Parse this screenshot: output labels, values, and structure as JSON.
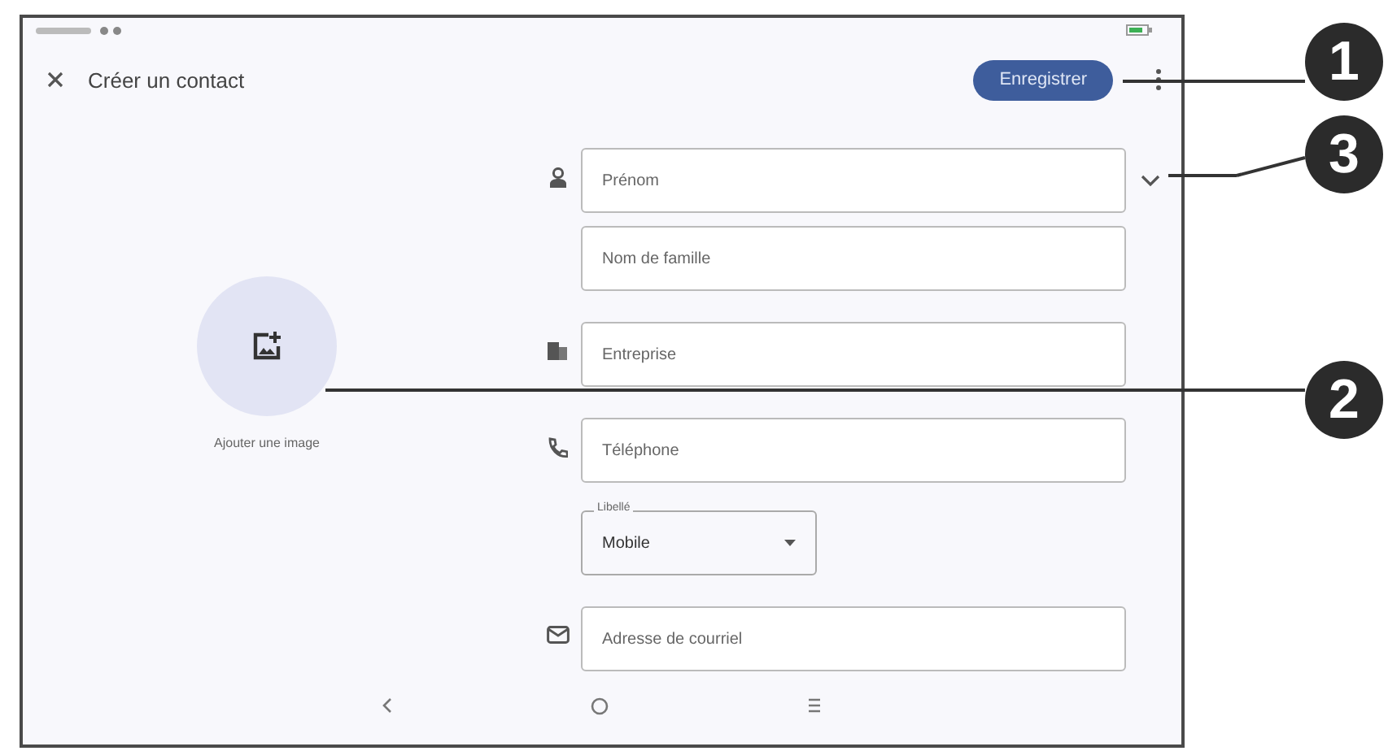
{
  "header": {
    "title": "Créer un contact",
    "save_button": "Enregistrer"
  },
  "photo": {
    "label": "Ajouter une image"
  },
  "sections": [
    {
      "kind": "name",
      "expandable": true,
      "fields": [
        {
          "placeholder": "Prénom"
        },
        {
          "placeholder": "Nom de famille"
        }
      ]
    },
    {
      "kind": "company",
      "expandable": false,
      "fields": [
        {
          "placeholder": "Entreprise"
        }
      ]
    },
    {
      "kind": "phone",
      "expandable": false,
      "fields": [
        {
          "placeholder": "Téléphone"
        }
      ],
      "type_select": {
        "label": "Libellé",
        "value": "Mobile"
      }
    },
    {
      "kind": "email",
      "expandable": false,
      "fields": [
        {
          "placeholder": "Adresse de courriel"
        }
      ]
    }
  ],
  "callouts": [
    {
      "number": "1"
    },
    {
      "number": "3"
    },
    {
      "number": "2"
    }
  ]
}
